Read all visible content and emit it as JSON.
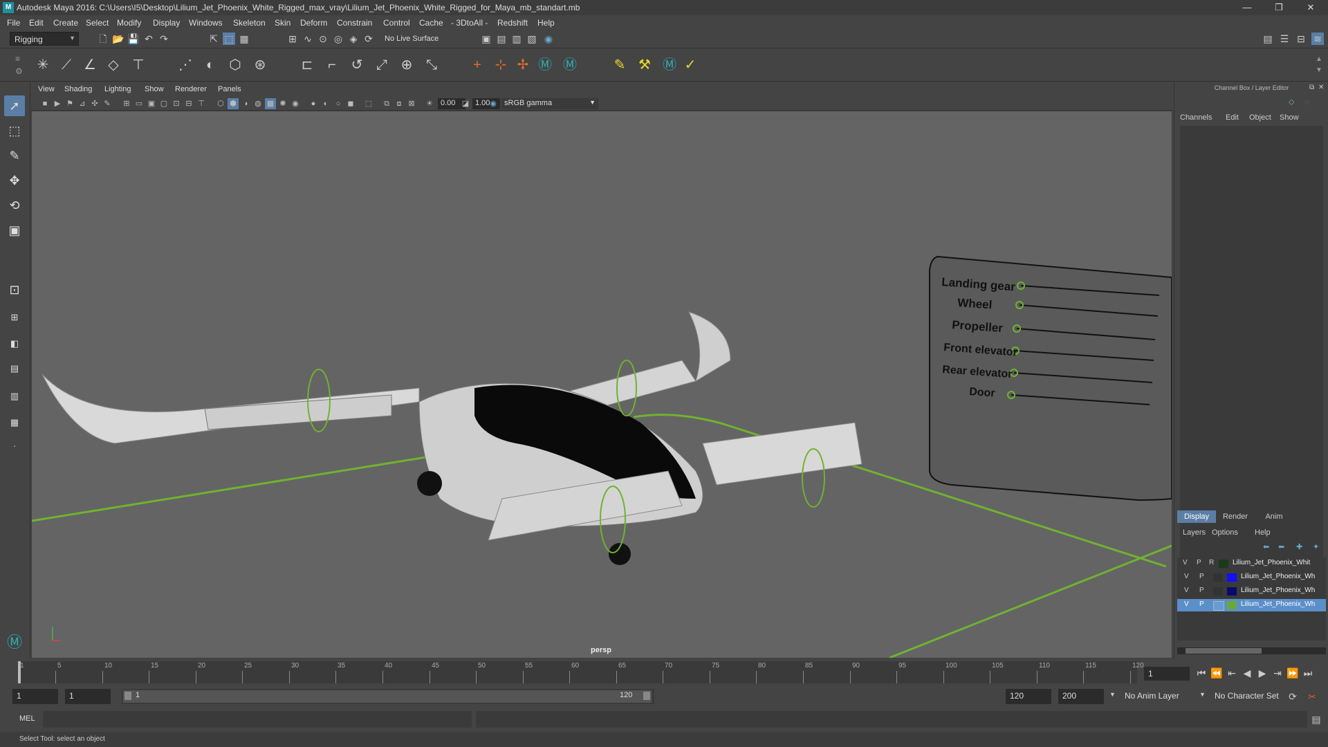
{
  "window": {
    "title": "Autodesk Maya 2016: C:\\Users\\I5\\Desktop\\Lilium_Jet_Phoenix_White_Rigged_max_vray\\Lilium_Jet_Phoenix_White_Rigged_for_Maya_mb_standart.mb",
    "minimize": "—",
    "maximize": "❐",
    "close": "✕"
  },
  "menubar": [
    "File",
    "Edit",
    "Create",
    "Select",
    "Modify",
    "Display",
    "Windows",
    "Skeleton",
    "Skin",
    "Deform",
    "Constrain",
    "Control",
    "Cache",
    "- 3DtoAll -",
    "Redshift",
    "Help"
  ],
  "status": {
    "mode": "Rigging",
    "live_surface": "No Live Surface"
  },
  "panel": {
    "menus": [
      "View",
      "Shading",
      "Lighting",
      "Show",
      "Renderer",
      "Panels"
    ],
    "exposure": "0.00",
    "gamma": "1.00",
    "color_space": "sRGB gamma",
    "camera_label": "persp"
  },
  "rig_labels": [
    "Landing gear",
    "Wheel",
    "Propeller",
    "Front elevator",
    "Rear elevator",
    "Door"
  ],
  "channel_box": {
    "title": "Channel Box / Layer Editor",
    "menus": [
      "Channels",
      "Edit",
      "Object",
      "Show"
    ]
  },
  "layer_editor": {
    "tabs": [
      "Display",
      "Render",
      "Anim"
    ],
    "menus": [
      "Layers",
      "Options",
      "Help"
    ],
    "layers": [
      {
        "v": "V",
        "p": "P",
        "r": "R",
        "name": "Lilium_Jet_Phoenix_Whit",
        "color": "#1a3a1a"
      },
      {
        "v": "V",
        "p": "P",
        "r": "",
        "name": "Lilium_Jet_Phoenix_Wh",
        "color": "#1010ff"
      },
      {
        "v": "V",
        "p": "P",
        "r": "",
        "name": "Lilium_Jet_Phoenix_Wh",
        "color": "#0a0a6a"
      },
      {
        "v": "V",
        "p": "P",
        "r": "",
        "name": "Lilium_Jet_Phoenix_Wh",
        "color": "#6aa83a"
      }
    ]
  },
  "timeline": {
    "ticks": [
      "1",
      "5",
      "10",
      "15",
      "20",
      "25",
      "30",
      "35",
      "40",
      "45",
      "50",
      "55",
      "60",
      "65",
      "70",
      "75",
      "80",
      "85",
      "90",
      "95",
      "100",
      "105",
      "110",
      "115",
      "120"
    ],
    "current_frame": "1"
  },
  "range": {
    "start": "1",
    "playback_start": "1",
    "slider_start": "1",
    "slider_end": "120",
    "playback_end": "120",
    "end": "200",
    "anim_layer": "No Anim Layer",
    "character_set": "No Character Set"
  },
  "command": {
    "lang": "MEL"
  },
  "help_line": "Select Tool: select an object",
  "colors": {
    "accent": "#5b7ea6",
    "green_rig": "#6fb330",
    "selected_row": "#5b8fc9"
  }
}
